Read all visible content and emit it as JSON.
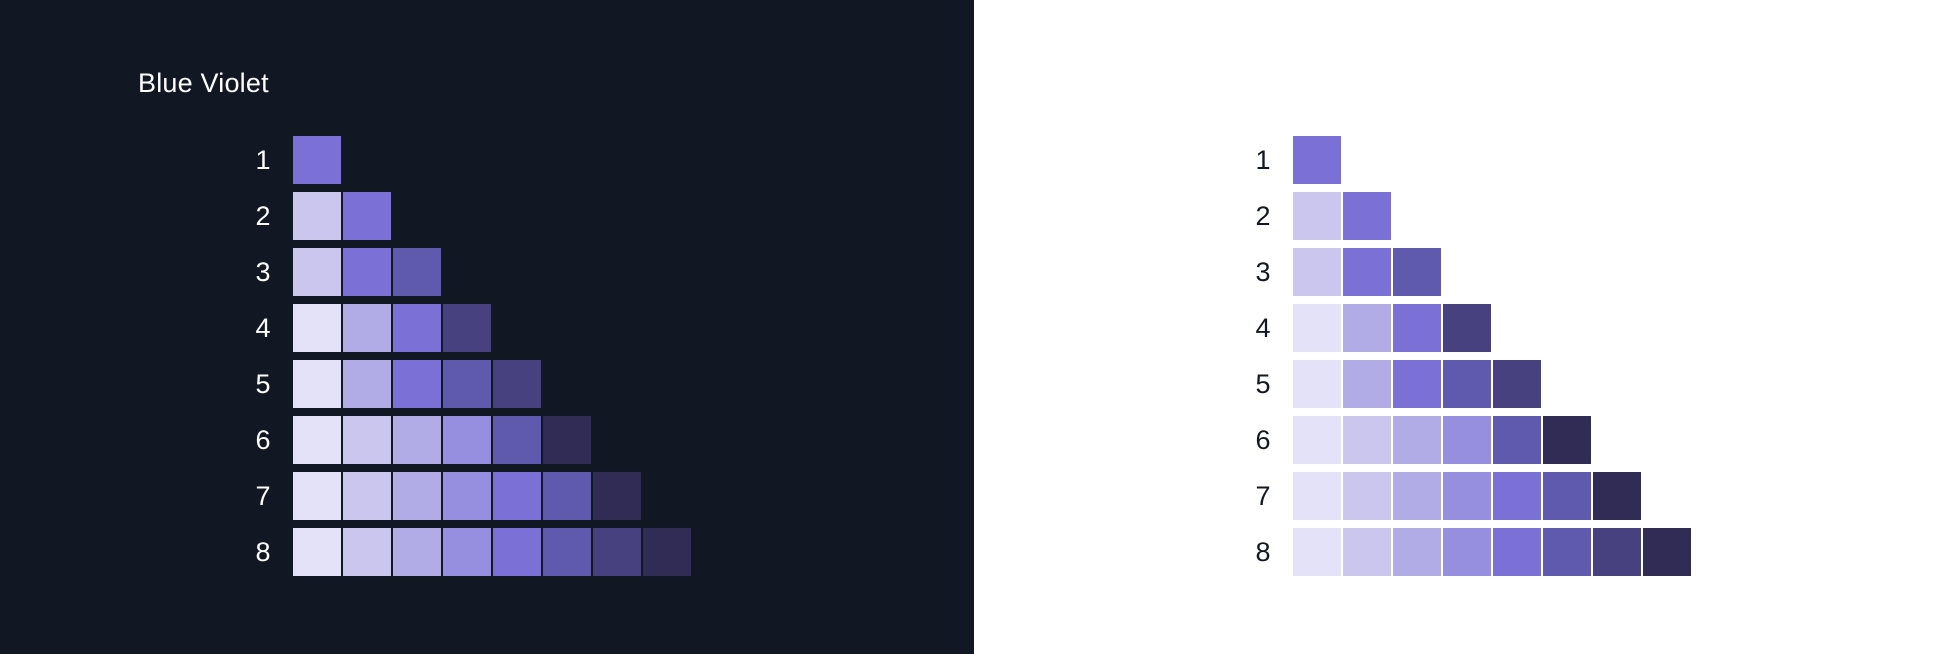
{
  "title": "Blue Violet",
  "row_labels": [
    "1",
    "2",
    "3",
    "4",
    "5",
    "6",
    "7",
    "8"
  ],
  "palette": {
    "background_dark": "#111823",
    "background_light": "#ffffff",
    "rows": [
      [
        "#7a70d6"
      ],
      [
        "#cbc6ee",
        "#7a70d6"
      ],
      [
        "#cbc6ee",
        "#7a70d6",
        "#605aae"
      ],
      [
        "#e4e2f8",
        "#b1ace6",
        "#7a70d6",
        "#47417f"
      ],
      [
        "#e4e2f8",
        "#b1ace6",
        "#7a70d6",
        "#605aae",
        "#47417f"
      ],
      [
        "#e4e2f8",
        "#cbc6ee",
        "#b1ace6",
        "#968fe0",
        "#605aae",
        "#312c56"
      ],
      [
        "#e4e2f8",
        "#cbc6ee",
        "#b1ace6",
        "#968fe0",
        "#7a70d6",
        "#605aae",
        "#312c56"
      ],
      [
        "#e4e2f8",
        "#cbc6ee",
        "#b1ace6",
        "#968fe0",
        "#7a70d6",
        "#605aae",
        "#47417f",
        "#312c56"
      ]
    ]
  }
}
